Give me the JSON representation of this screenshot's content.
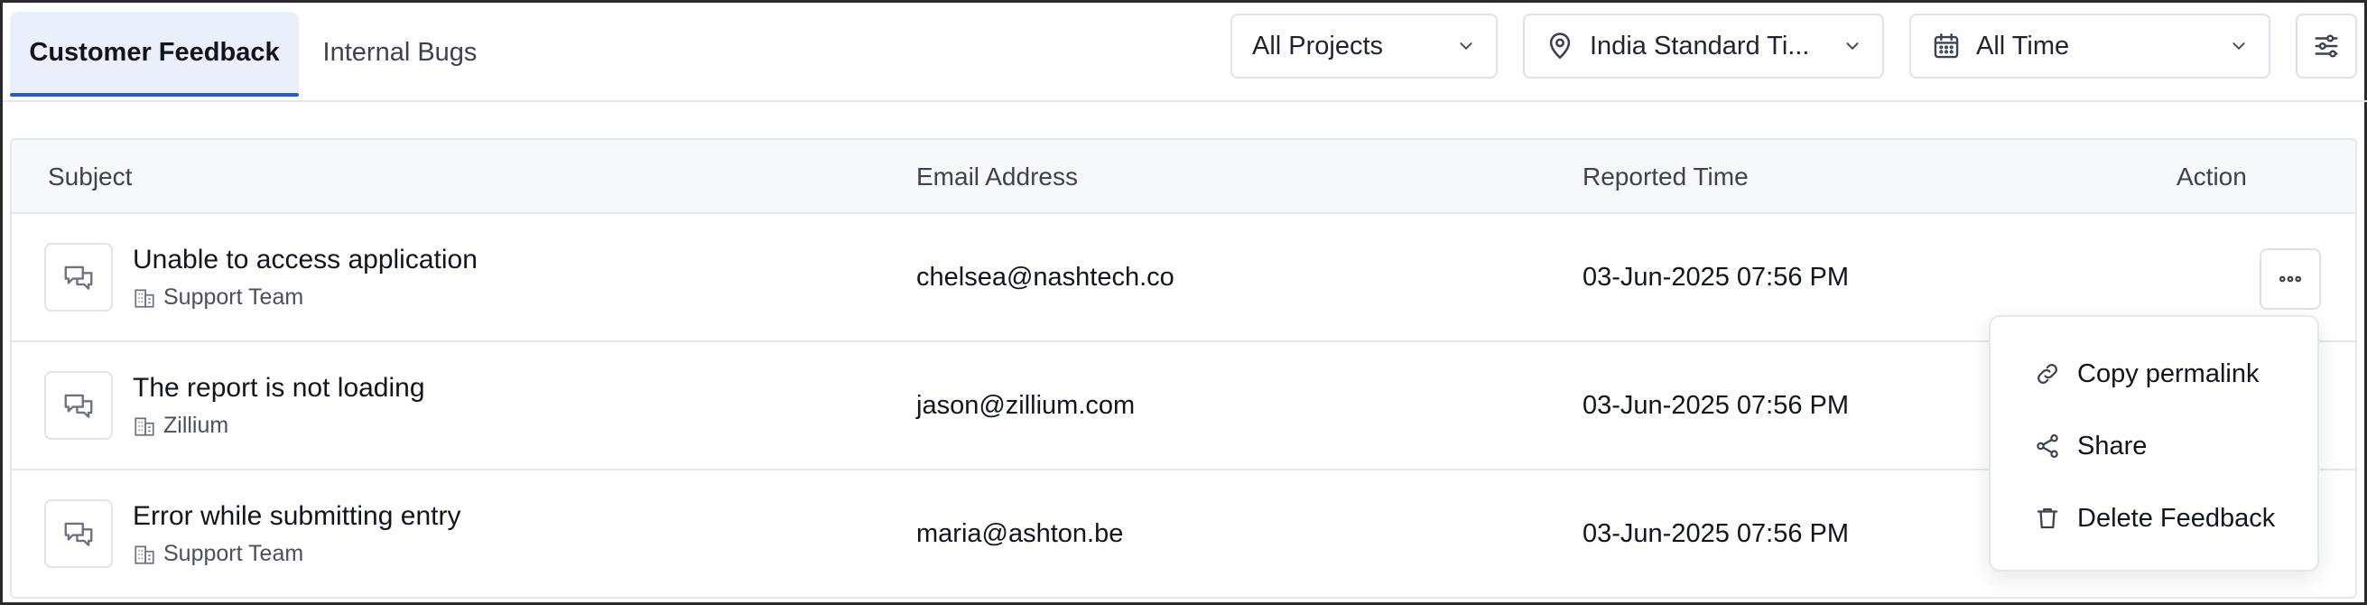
{
  "tabs": [
    {
      "label": "Customer Feedback",
      "active": true
    },
    {
      "label": "Internal Bugs",
      "active": false
    }
  ],
  "filters": {
    "projects": "All Projects",
    "timezone": "India Standard Ti...",
    "time_range": "All Time"
  },
  "table": {
    "columns": [
      "Subject",
      "Email Address",
      "Reported Time",
      "Action"
    ],
    "rows": [
      {
        "subject": "Unable to access application",
        "team": "Support Team",
        "email": "chelsea@nashtech.co",
        "reported_time": "03-Jun-2025 07:56 PM"
      },
      {
        "subject": "The report is not loading",
        "team": "Zillium",
        "email": "jason@zillium.com",
        "reported_time": "03-Jun-2025 07:56 PM"
      },
      {
        "subject": "Error while submitting entry",
        "team": "Support Team",
        "email": "maria@ashton.be",
        "reported_time": "03-Jun-2025 07:56 PM"
      }
    ]
  },
  "action_menu": {
    "items": [
      {
        "label": "Copy permalink",
        "icon": "link-icon"
      },
      {
        "label": "Share",
        "icon": "share-icon"
      },
      {
        "label": "Delete Feedback",
        "icon": "trash-icon"
      }
    ]
  },
  "colors": {
    "accent": "#2a5bd7",
    "active_tab_bg": "#eaf0fb",
    "border": "#e4e7ec",
    "header_bg": "#f7f8fa"
  }
}
